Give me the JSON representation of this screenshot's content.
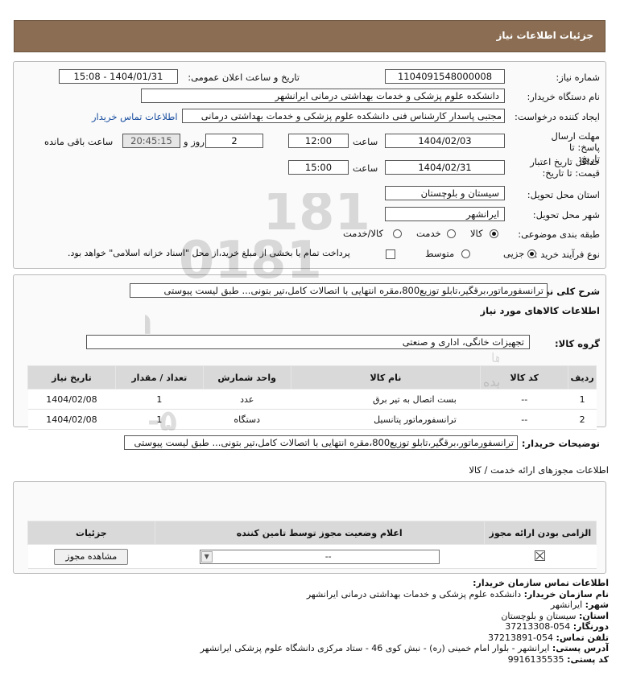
{
  "header": {
    "title": "جزئیات اطلاعات نیاز"
  },
  "fields": {
    "need_number_label": "شماره نیاز:",
    "need_number": "1104091548000008",
    "announce_label": "تاریخ و ساعت اعلان عمومی:",
    "announce_value": "1404/01/31 - 15:08",
    "buyer_label": "نام دستگاه خریدار:",
    "buyer_value": "دانشکده علوم پزشکی و خدمات بهداشتی درمانی ایرانشهر",
    "requester_label": "ایجاد کننده درخواست:",
    "requester_value": "مجتبی پاسدار کارشناس فنی دانشکده علوم پزشکی و خدمات بهداشتی درمانی",
    "contact_link": "اطلاعات تماس خریدار",
    "deadline_label": "مهلت ارسال پاسخ: تا تاریخ:",
    "deadline_date": "1404/02/03",
    "time_label": "ساعت",
    "deadline_time": "12:00",
    "days_count": "2",
    "days_label": "روز و",
    "remaining_time": "20:45:15",
    "remaining_label": "ساعت باقی مانده",
    "validity_label": "حداقل تاریخ اعتبار قیمت: تا تاریخ:",
    "validity_date": "1404/02/31",
    "validity_time": "15:00",
    "province_label": "استان محل تحویل:",
    "province_value": "سیستان و بلوچستان",
    "city_label": "شهر محل تحویل:",
    "city_value": "ایرانشهر",
    "category_label": "طبقه بندی موضوعی:",
    "category_options": [
      "کالا",
      "خدمت",
      "کالا/خدمت"
    ],
    "process_label": "نوع فرآیند خرید :",
    "process_options": [
      "جزیی",
      "متوسط"
    ],
    "treasury_note": "پرداخت تمام یا بخشی از مبلغ خرید،از محل \"اسناد خزانه اسلامی\" خواهد بود."
  },
  "general": {
    "desc_label": "شرح کلی نیاز:",
    "desc_value": "ترانسفورماتور،برقگیر،تابلو توزیع800،مقره انتهایی با اتصالات کامل،تیر بتونی... طبق لیست پیوستی",
    "goods_info_title": "اطلاعات کالاهای مورد نیاز",
    "group_label": "گروه کالا:",
    "group_value": "تجهیزات خانگی، اداری و صنعتی"
  },
  "goods_table": {
    "headers": [
      "ردیف",
      "کد کالا",
      "نام کالا",
      "واحد شمارش",
      "تعداد / مقدار",
      "تاریخ نیاز"
    ],
    "rows": [
      [
        "1",
        "--",
        "بست اتصال به تیر برق",
        "عدد",
        "1",
        "1404/02/08"
      ],
      [
        "2",
        "--",
        "ترانسفورماتور پتانسیل",
        "دستگاه",
        "1",
        "1404/02/08"
      ]
    ]
  },
  "buyer_notes": {
    "label": "توضیحات خریدار:",
    "value": "ترانسفورماتور،برقگیر،تابلو توزیع800،مقره انتهایی با اتصالات کامل،تیر بتونی... طبق لیست پیوستی"
  },
  "permits": {
    "title": "اطلاعات مجوزهای ارائه خدمت / کالا",
    "headers": [
      "الزامی بودن ارائه مجوز",
      "اعلام وضعیت مجوز توسط تامین کننده",
      "جزئیات"
    ],
    "select_value": "--",
    "view_button": "مشاهده مجوز"
  },
  "contact": {
    "title": "اطلاعات تماس سازمان خریدار:",
    "lines": [
      {
        "label": "نام سازمان خریدار:",
        "value": "دانشکده علوم پزشکی و خدمات بهداشتی درمانی ایرانشهر"
      },
      {
        "label": "شهر:",
        "value": "ایرانشهر"
      },
      {
        "label": "استان:",
        "value": "سیستان و بلوچستان"
      },
      {
        "label": "دورنگار:",
        "value": "054-37213308"
      },
      {
        "label": "تلفن تماس:",
        "value": "054-37213891"
      },
      {
        "label": "آدرس پستی:",
        "value": "ایرانشهر - بلوار امام خمینی (ره) - نبش کوی 46 - ستاد مرکزی دانشگاه علوم پزشکی ایرانشهر"
      },
      {
        "label": "کد پستی:",
        "value": "9916135535"
      }
    ]
  },
  "watermark": {
    "brand": "ParsNamadData",
    "line1": "مرکز فراهم آوری و نشر اطلاعات پارس نماد داده ها",
    "line2": "پایگاه اطلاع رسانی مناقصه و مزایده",
    "phone": "۰۲۱-۸۸۳۴۹۶۷۰-۵"
  },
  "colors": {
    "header_bg": "#8a6d52",
    "table_head": "#d9d9d9",
    "link": "#1a4fa0"
  }
}
